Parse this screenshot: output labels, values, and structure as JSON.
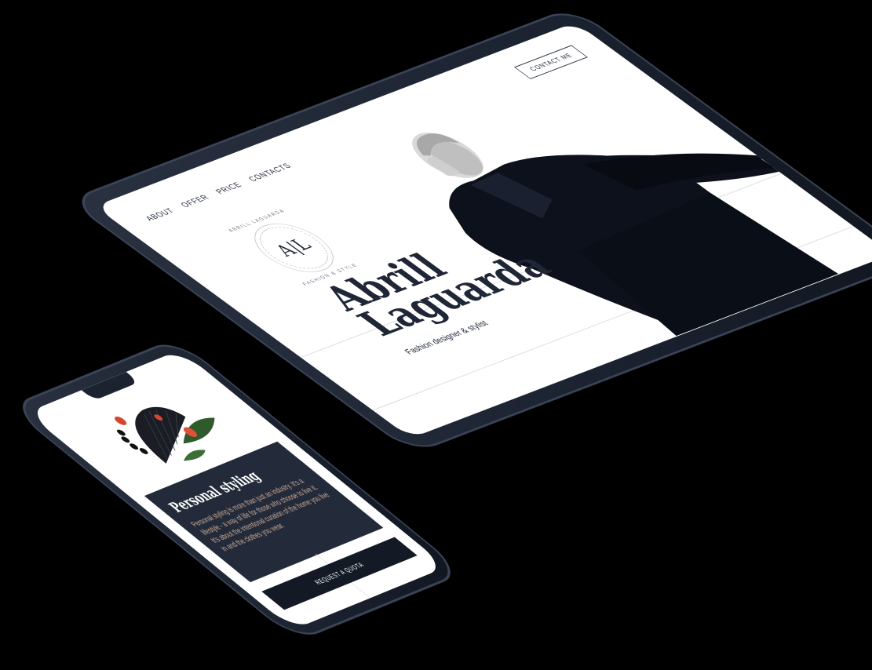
{
  "tablet": {
    "nav": {
      "items": [
        {
          "label": "ABOUT"
        },
        {
          "label": "OFFER"
        },
        {
          "label": "PRICE"
        },
        {
          "label": "CONTACTS"
        }
      ]
    },
    "contact_button": "CONTACT ME",
    "logo": {
      "mark": "A|L",
      "ring_top": "ABRILL LAGUARDA",
      "ring_bottom": "FASHION & STYLE"
    },
    "hero": {
      "title_line1": "Abrill",
      "title_line2": "Laguarda",
      "subtitle": "Fashion designer & stylist"
    }
  },
  "phone": {
    "section": {
      "title": "Personal styling",
      "body": "Personal styling is more than just an industry. It's a lifestyle - a way of life for those who choose to live it. It's about the intentional curation of the home you live in and the clothes you wear."
    },
    "cta_button": "REQUEST A QUOTA"
  },
  "colors": {
    "device_frame": "#1b2230",
    "navy_card": "#232b3a",
    "cta_bg": "#141a25",
    "body_text_warm": "#c9a995",
    "ink": "#1f2636"
  }
}
